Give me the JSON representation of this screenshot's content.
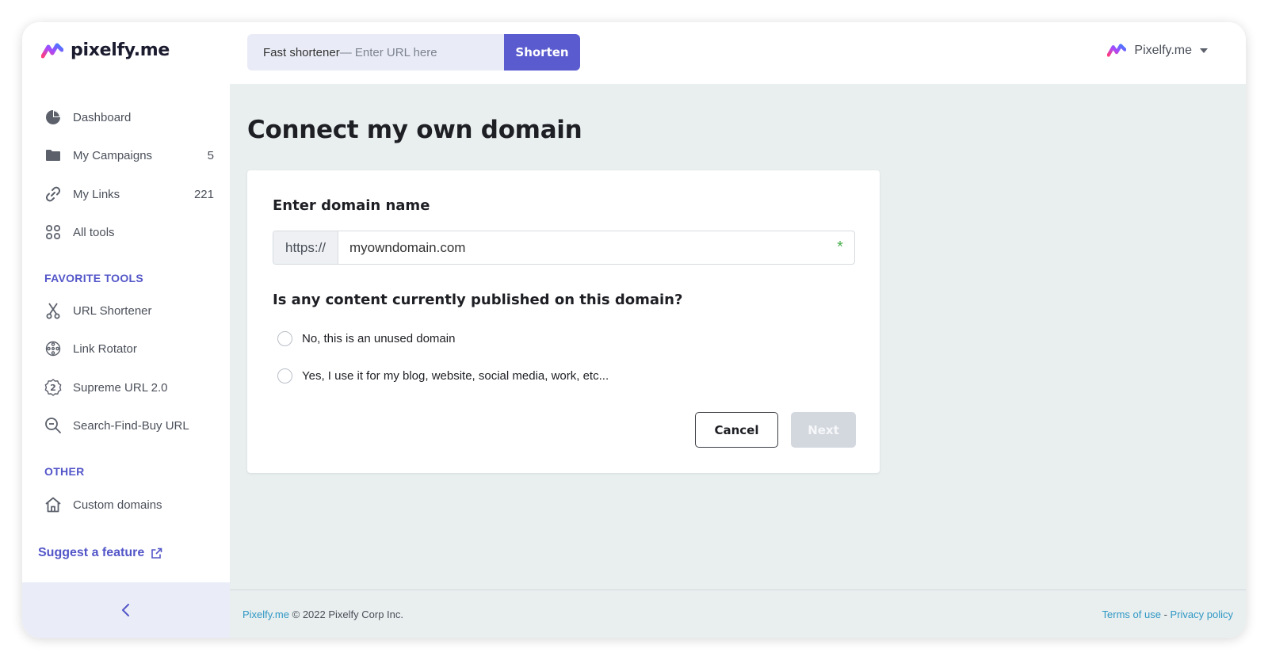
{
  "brand": {
    "name": "pixelfy.me"
  },
  "topbar": {
    "shortener_label": "Fast shortener",
    "shortener_placeholder": "— Enter URL here",
    "shorten_button": "Shorten",
    "account_name": "Pixelfy.me"
  },
  "sidebar": {
    "main_items": [
      {
        "label": "Dashboard",
        "count": "",
        "icon": "pie-chart-icon"
      },
      {
        "label": "My Campaigns",
        "count": "5",
        "icon": "folder-icon"
      },
      {
        "label": "My Links",
        "count": "221",
        "icon": "link-icon"
      },
      {
        "label": "All tools",
        "count": "",
        "icon": "grid-icon"
      }
    ],
    "favorite_title": "FAVORITE TOOLS",
    "favorite_items": [
      {
        "label": "URL Shortener",
        "icon": "scissors-icon"
      },
      {
        "label": "Link Rotator",
        "icon": "rotator-icon"
      },
      {
        "label": "Supreme URL 2.0",
        "icon": "badge-2-icon"
      },
      {
        "label": "Search-Find-Buy URL",
        "icon": "search-icon"
      }
    ],
    "other_title": "OTHER",
    "other_items": [
      {
        "label": "Custom domains",
        "icon": "home-icon"
      }
    ],
    "suggest_label": "Suggest a feature"
  },
  "main": {
    "page_title": "Connect my own domain",
    "domain_heading": "Enter domain name",
    "domain_prefix": "https://",
    "domain_value": "myowndomain.com",
    "required_mark": "*",
    "question": "Is any content currently published on this domain?",
    "options": [
      "No, this is an unused domain",
      "Yes, I use it for my blog, website, social media, work, etc..."
    ],
    "cancel_label": "Cancel",
    "next_label": "Next"
  },
  "footer": {
    "brand_link": "Pixelfy.me",
    "copyright": "© 2022 Pixelfy Corp Inc.",
    "terms": "Terms of use",
    "separator": "-",
    "privacy": "Privacy policy"
  },
  "colors": {
    "accent": "#5a5bcf",
    "sidebar_section": "#5356c8",
    "main_bg": "#e9eeef",
    "link": "#2f98c4",
    "required": "#4cb050"
  }
}
